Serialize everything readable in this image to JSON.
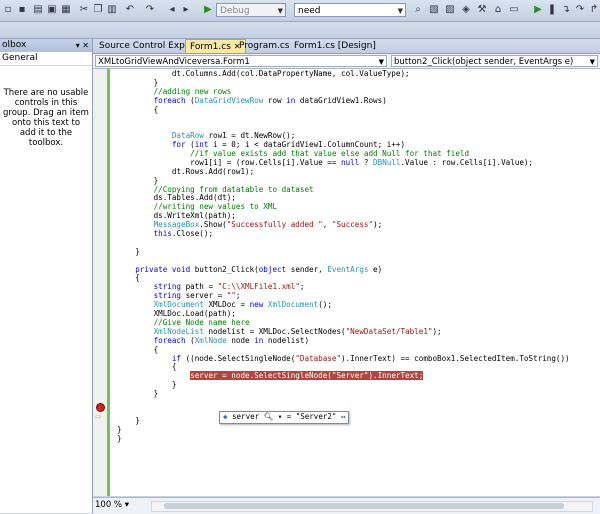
{
  "toolbar": {
    "config": "Debug",
    "search": "need"
  },
  "toolbox": {
    "title": "olbox",
    "pins": "▾ ✕",
    "group": "General",
    "message": "There are no usable controls in this group. Drag an item onto this text to add it to the toolbox."
  },
  "tabs": [
    {
      "label": "Source Control Explorer"
    },
    {
      "label": "Form1.cs"
    },
    {
      "label": "Program.cs"
    },
    {
      "label": "Form1.cs [Design]"
    }
  ],
  "navbar": {
    "class_combo": "XMLtoGridViewAndViceversa.Form1",
    "member_combo": "button2_Click(object sender, EventArgs e)"
  },
  "code": [
    {
      "n": 0,
      "parts": [
        [
          "",
          "            dt.Columns.Add(col.DataPropertyName, col.ValueType);"
        ]
      ]
    },
    {
      "n": 1,
      "parts": [
        [
          "",
          "        }"
        ]
      ]
    },
    {
      "n": 2,
      "parts": [
        [
          "cm",
          "        //adding new rows"
        ]
      ]
    },
    {
      "n": 3,
      "parts": [
        [
          "kw",
          "        foreach"
        ],
        [
          "",
          " ("
        ],
        [
          "ty",
          "DataGridViewRow"
        ],
        [
          "",
          " row "
        ],
        [
          "kw",
          "in"
        ],
        [
          "",
          " dataGridView1.Rows)"
        ]
      ]
    },
    {
      "n": 4,
      "parts": [
        [
          "",
          "        {"
        ]
      ]
    },
    {
      "n": 5,
      "parts": [
        [
          "",
          ""
        ]
      ]
    },
    {
      "n": 6,
      "parts": [
        [
          "",
          ""
        ]
      ]
    },
    {
      "n": 7,
      "parts": [
        [
          "ty",
          "            DataRow"
        ],
        [
          "",
          " row1 = dt.NewRow();"
        ]
      ]
    },
    {
      "n": 8,
      "parts": [
        [
          "kw",
          "            for"
        ],
        [
          "",
          " ("
        ],
        [
          "kw",
          "int"
        ],
        [
          "",
          " i = 0; i < dataGridView1.ColumnCount; i++)"
        ]
      ]
    },
    {
      "n": 9,
      "parts": [
        [
          "cm",
          "                //if value exists add that value else add Null for that field"
        ]
      ]
    },
    {
      "n": 10,
      "parts": [
        [
          "",
          "                row1[i] = (row.Cells[i].Value == "
        ],
        [
          "kw",
          "null"
        ],
        [
          "",
          " ? "
        ],
        [
          "ty",
          "DBNull"
        ],
        [
          "",
          ".Value : row.Cells[i].Value);"
        ]
      ]
    },
    {
      "n": 11,
      "parts": [
        [
          "",
          "            dt.Rows.Add(row1);"
        ]
      ]
    },
    {
      "n": 12,
      "parts": [
        [
          "",
          "        }"
        ]
      ]
    },
    {
      "n": 13,
      "parts": [
        [
          "cm",
          "        //Copying from datatable to dataset"
        ]
      ]
    },
    {
      "n": 14,
      "parts": [
        [
          "",
          "        ds.Tables.Add(dt);"
        ]
      ]
    },
    {
      "n": 15,
      "parts": [
        [
          "cm",
          "        //writing new values to XML"
        ]
      ]
    },
    {
      "n": 16,
      "parts": [
        [
          "",
          "        ds.WriteXml(path);"
        ]
      ]
    },
    {
      "n": 17,
      "parts": [
        [
          "ty",
          "        MessageBox"
        ],
        [
          "",
          ".Show("
        ],
        [
          "st",
          "\"Successfully added \""
        ],
        [
          "",
          ", "
        ],
        [
          "st",
          "\"Success\""
        ],
        [
          "",
          ");"
        ]
      ]
    },
    {
      "n": 18,
      "parts": [
        [
          "kw",
          "        this"
        ],
        [
          "",
          ".Close();"
        ]
      ]
    },
    {
      "n": 19,
      "parts": [
        [
          "",
          ""
        ]
      ]
    },
    {
      "n": 20,
      "parts": [
        [
          "",
          "    }"
        ]
      ]
    },
    {
      "n": 21,
      "parts": [
        [
          "",
          ""
        ]
      ]
    },
    {
      "n": 22,
      "parts": [
        [
          "kw",
          "    private void"
        ],
        [
          "",
          " button2_Click("
        ],
        [
          "kw",
          "object"
        ],
        [
          "",
          " sender, "
        ],
        [
          "ty",
          "EventArgs"
        ],
        [
          "",
          " e)"
        ]
      ]
    },
    {
      "n": 23,
      "parts": [
        [
          "",
          "    {"
        ]
      ]
    },
    {
      "n": 24,
      "parts": [
        [
          "kw",
          "        string"
        ],
        [
          "",
          " path = "
        ],
        [
          "st",
          "\"C:\\\\XMLFile1.xml\""
        ],
        [
          "",
          ";"
        ]
      ]
    },
    {
      "n": 25,
      "parts": [
        [
          "kw",
          "        string"
        ],
        [
          "",
          " server = "
        ],
        [
          "st",
          "\"\""
        ],
        [
          "",
          ";"
        ]
      ]
    },
    {
      "n": 26,
      "parts": [
        [
          "ty",
          "        XmlDocument"
        ],
        [
          "",
          " XMLDoc = "
        ],
        [
          "kw",
          "new"
        ],
        [
          "ty",
          " XmlDocument"
        ],
        [
          "",
          "();"
        ]
      ]
    },
    {
      "n": 27,
      "parts": [
        [
          "",
          "        XMLDoc.Load(path);"
        ]
      ]
    },
    {
      "n": 28,
      "parts": [
        [
          "cm",
          "        //Give Node name here"
        ]
      ]
    },
    {
      "n": 29,
      "parts": [
        [
          "ty",
          "        XmlNodeList"
        ],
        [
          "",
          " nodelist = XMLDoc.SelectNodes("
        ],
        [
          "st",
          "\"NewDataSet/Table1\""
        ],
        [
          "",
          ");"
        ]
      ]
    },
    {
      "n": 30,
      "parts": [
        [
          "kw",
          "        foreach"
        ],
        [
          "",
          " ("
        ],
        [
          "ty",
          "XmlNode"
        ],
        [
          "",
          " node "
        ],
        [
          "kw",
          "in"
        ],
        [
          "",
          " nodelist)"
        ]
      ]
    },
    {
      "n": 31,
      "parts": [
        [
          "",
          "        {"
        ]
      ]
    },
    {
      "n": 32,
      "parts": [
        [
          "kw",
          "            if"
        ],
        [
          "",
          " ((node.SelectSingleNode("
        ],
        [
          "st",
          "\"Database\""
        ],
        [
          "",
          ").InnerText) == comboBox1.SelectedItem.ToString())"
        ]
      ]
    },
    {
      "n": 33,
      "parts": [
        [
          "",
          "            {"
        ]
      ]
    },
    {
      "n": 34,
      "parts": [
        [
          "",
          "                "
        ],
        [
          "hl",
          "server = node.SelectSingleNode(\"Server\").InnerText;"
        ]
      ]
    },
    {
      "n": 35,
      "parts": [
        [
          "",
          "            }"
        ]
      ]
    },
    {
      "n": 36,
      "parts": [
        [
          "",
          "        }"
        ]
      ]
    },
    {
      "n": 37,
      "parts": [
        [
          "",
          ""
        ]
      ]
    },
    {
      "n": 38,
      "parts": [
        [
          "",
          ""
        ]
      ]
    },
    {
      "n": 39,
      "parts": [
        [
          "",
          "    }"
        ]
      ]
    },
    {
      "n": 40,
      "parts": [
        [
          "",
          "}"
        ]
      ]
    },
    {
      "n": 41,
      "parts": [
        [
          "",
          "}"
        ]
      ]
    }
  ],
  "tooltip": {
    "var": "server",
    "value": "\"Server2\""
  },
  "status": {
    "zoom": "100 %"
  }
}
